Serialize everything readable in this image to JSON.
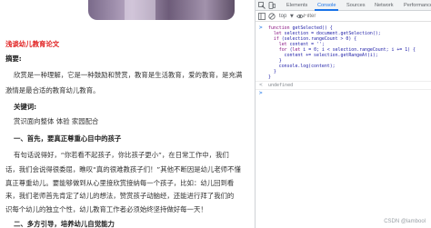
{
  "article": {
    "title": "浅谈幼儿教育论文",
    "abstract_label": "摘要:",
    "abstract_lines": [
      "欣赏是一种理解，它是一种鼓励和赞赏，教育是生活教育，爱的教育，是充满",
      "激情是最合适的教育幼儿教育。"
    ],
    "keywords_label": "关键词:",
    "keywords": "赏识面向整体 体验 家园配合",
    "section1_title": "一、首先，要真正尊重心目中的孩子",
    "section1_lines": [
      "有句话说得好，“你若看不起孩子，你比孩子更小”，在日常工作中，我们",
      "话，我们会说得很委屈，瞧叹“真的很难教孩子们！”其他不断因是幼儿老师不懂",
      "真正尊重幼儿。要能够做到从心里接欣赏接纳每一个孩子，比如：幼儿回到看",
      "来，我们老师首先肯定了幼儿的想法，赞赏孩子动脑经，还能进行拜了我们的",
      "识每个幼儿的独立个性，幼儿教育工作者必须始终坚持做好每一天！"
    ],
    "section2_title": "二、多方引导，培养幼儿自觉能力"
  },
  "devtools": {
    "tabs": [
      "Elements",
      "Console",
      "Sources",
      "Network",
      "Performance"
    ],
    "active_tab": "Console",
    "context": "top",
    "filter_placeholder": "Filter",
    "code_lines": [
      "function getSelected() {",
      "  let selection = document.getSelection();",
      "  if (selection.rangeCount > 0) {",
      "    let content = '';",
      "    for (let i = 0; i < selection.rangeCount; i += 1) {",
      "      content += selection.getRangeAt(i);",
      "    }",
      "    console.log(content);",
      "  }",
      "}"
    ],
    "result": "undefined",
    "prompt_symbol": ">",
    "result_symbol": "<"
  },
  "watermark": "CSDN @lambool",
  "icons": [
    "select-element-icon",
    "device-toolbar-icon",
    "clear-console-icon",
    "eye-icon",
    "chevron-down-icon"
  ]
}
